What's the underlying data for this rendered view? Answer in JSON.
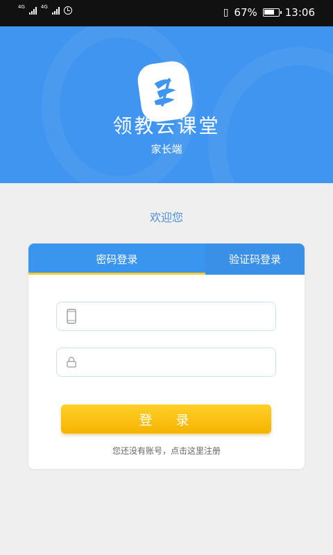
{
  "status_bar": {
    "network_1": "4G",
    "network_2": "4G",
    "battery_percent": "67%",
    "time": "13:06",
    "icons": [
      "signal-icon",
      "signal-icon",
      "alarm-clock-icon",
      "vibrate-icon",
      "battery-icon"
    ]
  },
  "header": {
    "app_name": "领教云课堂",
    "subtitle": "家长端",
    "background_color": "#3f95ef"
  },
  "welcome_text": "欢迎您",
  "login_card": {
    "tabs": [
      {
        "label": "密码登录",
        "active": true
      },
      {
        "label": "验证码登录",
        "active": false
      }
    ],
    "phone_input": {
      "value": "",
      "placeholder": "",
      "icon": "phone-icon"
    },
    "password_input": {
      "value": "",
      "placeholder": "",
      "icon": "lock-icon"
    },
    "login_button_label": "登 录",
    "register_text": "您还没有账号，点击这里注册"
  },
  "colors": {
    "accent": "#3a95ee",
    "tab_indicator": "#f7ce2e",
    "button": "#ffc107"
  }
}
